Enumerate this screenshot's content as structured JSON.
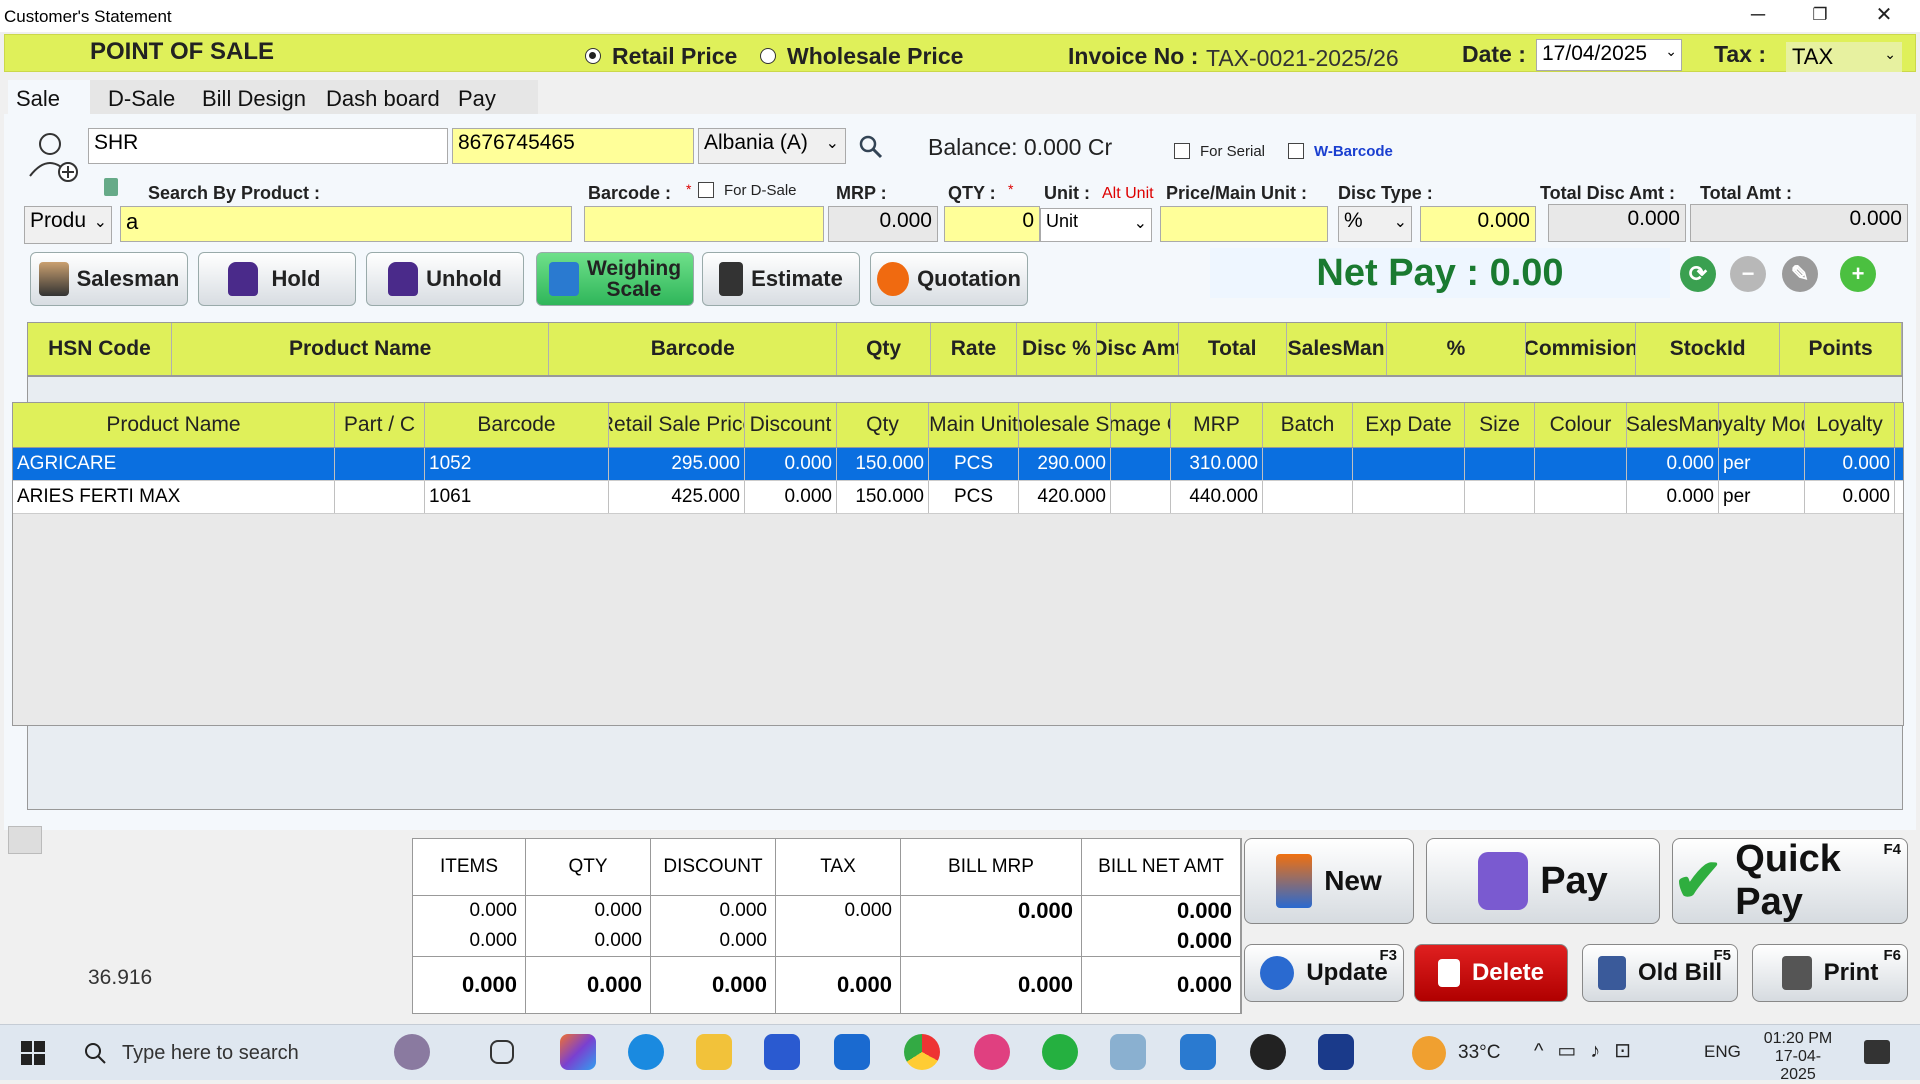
{
  "window": {
    "title": "Customer's Statement",
    "minimize": "─",
    "restore": "❐",
    "close": "✕"
  },
  "header": {
    "pos_title": "POINT OF SALE",
    "retail_price": "Retail Price",
    "wholesale_price": "Wholesale Price",
    "invoice_label": "Invoice No :",
    "invoice_value": "TAX-0021-2025/26",
    "date_label": "Date :",
    "date_value": "17/04/2025",
    "tax_label": "Tax :",
    "tax_value": "TAX"
  },
  "tabs": [
    "Sale",
    "D-Sale",
    "Bill Design",
    "Dash board",
    "Pay"
  ],
  "customer": {
    "name": "SHR",
    "phone": "8676745465",
    "country": "Albania (A)",
    "balance": "Balance: 0.000 Cr",
    "for_serial": "For Serial",
    "w_barcode": "W-Barcode"
  },
  "entry": {
    "search_label": "Search By Product :",
    "search_mode": "Produ",
    "search_value": "a",
    "barcode_label": "Barcode :",
    "barcode_star": "*",
    "for_dsale": "For D-Sale",
    "mrp_label": "MRP :",
    "mrp_value": "0.000",
    "qty_label": "QTY :",
    "qty_star": "*",
    "qty_value": "0",
    "unit_label": "Unit :",
    "alt_unit": "Alt Unit",
    "unit_value": "Unit",
    "price_label": "Price/Main Unit :",
    "disc_type_label": "Disc Type :",
    "disc_type_value": "%",
    "disc_value": "0.000",
    "total_disc_label": "Total Disc Amt :",
    "total_disc_value": "0.000",
    "total_amt_label": "Total Amt :",
    "total_amt_value": "0.000"
  },
  "buttons": {
    "salesman": "Salesman",
    "hold": "Hold",
    "unhold": "Unhold",
    "weighing_1": "Weighing",
    "weighing_2": "Scale",
    "estimate": "Estimate",
    "quotation": "Quotation"
  },
  "net_pay": "Net Pay : 0.00",
  "bill_grid_headers": [
    "HSN Code",
    "Product Name",
    "Barcode",
    "Qty",
    "Rate",
    "Disc %",
    "Disc Amt",
    "Total",
    "SalesMan",
    "%",
    "Commision",
    "StockId",
    "Points"
  ],
  "product_grid": {
    "headers": [
      "Product Name",
      "Part / C",
      "Barcode",
      "Retail Sale Price",
      "Discount",
      "Qty",
      "Main Unit",
      "Wholesale Sale",
      "Damage Qty",
      "MRP",
      "Batch",
      "Exp Date",
      "Size",
      "Colour",
      "SalesMan",
      "Loyalty Mode",
      "Loyalty"
    ],
    "rows": [
      {
        "name": "AGRICARE",
        "part": "",
        "barcode": "1052",
        "retail": "295.000",
        "discount": "0.000",
        "qty": "150.000",
        "unit": "PCS",
        "wholesale": "290.000",
        "damage": "",
        "mrp": "310.000",
        "batch": "",
        "exp": "",
        "size": "",
        "colour": "",
        "salesman": "0.000",
        "lmode": "per",
        "loyalty": "0.000"
      },
      {
        "name": "ARIES FERTI MAX",
        "part": "",
        "barcode": "1061",
        "retail": "425.000",
        "discount": "0.000",
        "qty": "150.000",
        "unit": "PCS",
        "wholesale": "420.000",
        "damage": "",
        "mrp": "440.000",
        "batch": "",
        "exp": "",
        "size": "",
        "colour": "",
        "salesman": "0.000",
        "lmode": "per",
        "loyalty": "0.000"
      }
    ]
  },
  "summary": {
    "headers": [
      "ITEMS",
      "QTY",
      "DISCOUNT",
      "TAX",
      "BILL MRP",
      "BILL NET AMT"
    ],
    "row1": [
      "0.000",
      "0.000",
      "0.000",
      "0.000",
      "0.000",
      "0.000"
    ],
    "row2": [
      "0.000",
      "0.000",
      "0.000",
      "",
      "",
      "0.000"
    ],
    "row3": [
      "0.000",
      "0.000",
      "0.000",
      "0.000",
      "0.000",
      "0.000"
    ]
  },
  "footer_value": "36.916",
  "actions": {
    "new": "New",
    "pay": "Pay",
    "quick_pay": "Quick Pay",
    "quick_pay_key": "F4",
    "update": "Update",
    "update_key": "F3",
    "delete": "Delete",
    "old_bill": "Old Bill",
    "old_bill_key": "F5",
    "print": "Print",
    "print_key": "F6"
  },
  "taskbar": {
    "search_placeholder": "Type here to search",
    "weather": "33°C",
    "lang": "ENG",
    "time": "01:20 PM",
    "date": "17-04-2025"
  }
}
